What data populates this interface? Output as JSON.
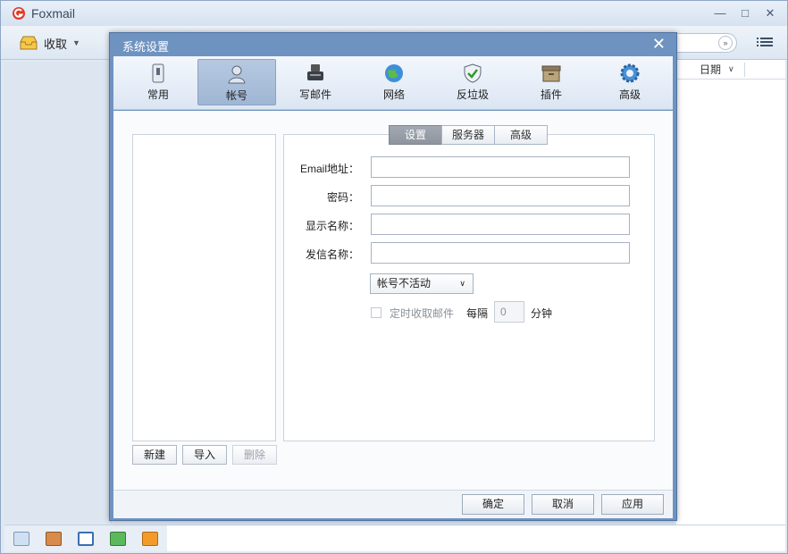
{
  "app": {
    "title": "Foxmail"
  },
  "toolbar": {
    "receive_label": "收取"
  },
  "mail_list": {
    "date_column": "日期"
  },
  "dialog": {
    "title": "系统设置",
    "tabs": [
      {
        "label": "常用",
        "icon": "general-icon"
      },
      {
        "label": "帐号",
        "icon": "account-icon"
      },
      {
        "label": "写邮件",
        "icon": "compose-icon"
      },
      {
        "label": "网络",
        "icon": "network-icon"
      },
      {
        "label": "反垃圾",
        "icon": "antispam-icon"
      },
      {
        "label": "插件",
        "icon": "plugin-icon"
      },
      {
        "label": "高级",
        "icon": "advanced-gear-icon"
      }
    ],
    "active_tab": "帐号",
    "account_buttons": {
      "new": "新建",
      "import": "导入",
      "delete": "删除"
    },
    "segment_tabs": [
      "设置",
      "服务器",
      "高级"
    ],
    "active_segment": "设置",
    "form": {
      "email_label": "Email地址：",
      "password_label": "密码：",
      "display_name_label": "显示名称：",
      "sender_name_label": "发信名称：",
      "email_value": "",
      "password_value": "",
      "display_name_value": "",
      "sender_name_value": "",
      "account_status": "帐号不活动",
      "scheduled_receive_label": "定时收取邮件",
      "every_label": "每隔",
      "interval_value": "0",
      "minutes_label": "分钟"
    },
    "footer": {
      "ok": "确定",
      "cancel": "取消",
      "apply": "应用"
    }
  },
  "colors": {
    "dialog_frame": "#6f93c0",
    "active_tab": "#9fb6d4",
    "active_segment": "#8d949e"
  }
}
